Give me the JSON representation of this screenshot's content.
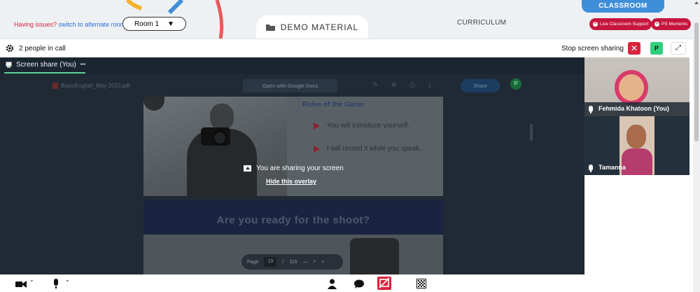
{
  "header": {
    "issues_text": "Having issues?",
    "alternate_link": "switch to alternate room",
    "room_select": "Room 1",
    "demo_material": "DEMO MATERIAL",
    "curriculum": "CURRICULUM",
    "classroom_tab": "CLASSROOM",
    "live_support": "Live Classroom Support",
    "ps_moments": "PS Moments"
  },
  "call": {
    "people_count": "2 people in call",
    "stop_share": "Stop screen sharing",
    "stop_icon": "✕",
    "avatar_initial": "P",
    "expand_icon": "⤢"
  },
  "stage": {
    "tab_label": "Screen share (You)",
    "tab_more": "•••",
    "pdf_name": "BasicEnglish_May 2023.pdf",
    "open_docs": "Open with Google Docs",
    "share_btn": "Share",
    "pdf_user": "P",
    "rules_title": "Rules of the Game",
    "rules": [
      "You will introduce yourself.",
      "I will record it while you speak."
    ],
    "banner": "Are you ready for the shoot?",
    "page_label": "Page",
    "page_current": "19",
    "page_sep": "/",
    "page_total": "115",
    "zoom_out": "—",
    "zoom_in": "+",
    "overlay_msg": "You are sharing your screen",
    "overlay_link": "Hide this overlay"
  },
  "participants": [
    {
      "name": "Fehmida Khatoon (You)"
    },
    {
      "name": "Tamanna"
    }
  ],
  "colors": {
    "accent_red": "#c5163d",
    "accent_blue": "#3f8ed8",
    "stage_bg": "#1f2a35",
    "green": "#2fd07c"
  }
}
